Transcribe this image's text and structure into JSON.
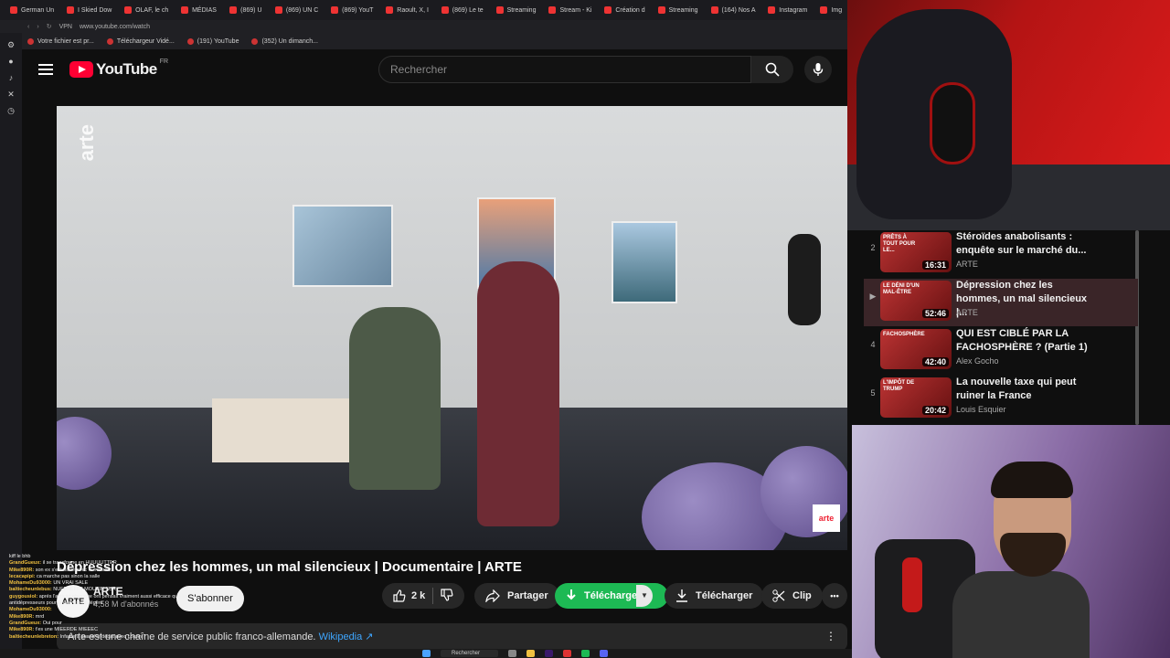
{
  "browser": {
    "tabs": [
      "German Un",
      "I Skied Dow",
      "OLAF, le ch",
      "MÉDIAS",
      "(869) U",
      "(869) UN C",
      "(869) YouT",
      "Raoult, X, I",
      "(869) Le te",
      "Streaming",
      "Stream - Ki",
      "Création d",
      "Streaming",
      "(164) Nos A",
      "Instagram",
      "Img"
    ],
    "url": "www.youtube.com/watch",
    "vpn_badge": "VPN",
    "bookmarks": [
      "Votre fichier est pr...",
      "Téléchargeur Vidé...",
      "(191) YouTube",
      "(352) Un dimanch..."
    ]
  },
  "youtube": {
    "logo_text": "YouTube",
    "country": "FR",
    "search_placeholder": "Rechercher"
  },
  "video": {
    "title": "Dépression chez les hommes, un mal silencieux | Documentaire | ARTE",
    "watermark": "arte",
    "corner_logo": "arte",
    "channel": "ARTE",
    "subscribers": "4,58 M d'abonnés",
    "subscribe_label": "S'abonner",
    "likes": "2 k",
    "share_label": "Partager",
    "download_green_label": "Télécharger",
    "download_label": "Télécharger",
    "clip_label": "Clip",
    "more_label": "•••",
    "description": "Arte est une chaîne de service public franco-allemande.",
    "wiki_link": "Wikipedia ↗"
  },
  "chat": [
    {
      "user": "",
      "msg": "kiff le bhb"
    },
    {
      "user": "GrandGueux:",
      "msg": "il se transforme en HUUUUTTER"
    },
    {
      "user": "Mike890R:",
      "msg": "son ex s'est barré avec le mesuez"
    },
    {
      "user": "lecacapipi:",
      "msg": "ca marche pas sinon la salle"
    },
    {
      "user": "MohameDu93000:",
      "msg": "UN VRAI SALE"
    },
    {
      "user": "baltiecheunlebus:",
      "msg": "NUFFREFFT MOUTIN SUR"
    },
    {
      "user": "guygousiol:",
      "msg": "aprés l'activité physique ont pensait vraiment aussi efficace que les antidépresseurs pour la dépression légère"
    },
    {
      "user": "MohameDu93000:",
      "msg": ""
    },
    {
      "user": "Mike890R:",
      "msg": "mrd"
    },
    {
      "user": "GrandGueux:",
      "msg": "Oui pour"
    },
    {
      "user": "Mike890R:",
      "msg": "t'es une MIEERDE MIEEEC"
    },
    {
      "user": "baltiecheunlebreton:",
      "msg": "Infame à quand le débat avec Loann ?"
    }
  ],
  "playlist": [
    {
      "index": "2",
      "title": "Stéroïdes anabolisants : enquête sur le marché du...",
      "channel": "ARTE",
      "duration": "16:31",
      "thumb_text": "PRÊTS À TOUT POUR LE...",
      "active": false
    },
    {
      "index": "▶",
      "title": "Dépression chez les hommes, un mal silencieux |...",
      "channel": "ARTE",
      "duration": "52:46",
      "thumb_text": "LE DÉNI D'UN MAL-ÊTRE",
      "active": true
    },
    {
      "index": "4",
      "title": "QUI EST CIBLÉ PAR LA FACHOSPHÈRE ? (Partie 1)",
      "channel": "Alex Gocho",
      "duration": "42:40",
      "thumb_text": "FACHOSPHÈRE",
      "active": false
    },
    {
      "index": "5",
      "title": "La nouvelle taxe qui peut ruiner la France",
      "channel": "Louis Esquier",
      "duration": "20:42",
      "thumb_text": "L'IMPÔT DE TRUMP",
      "active": false
    }
  ],
  "taskbar": {
    "search_label": "Rechercher"
  },
  "colors": {
    "yt_red": "#ff0033",
    "download_green": "#1db954",
    "link_blue": "#3ea6ff"
  }
}
